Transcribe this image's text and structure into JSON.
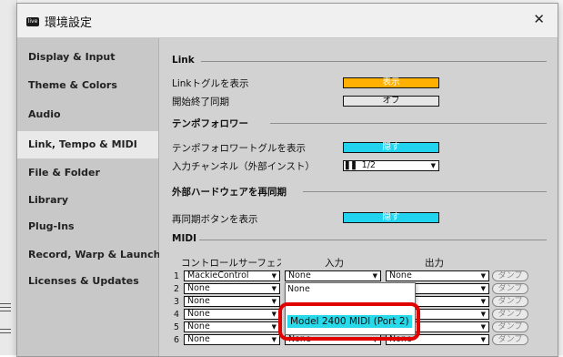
{
  "window": {
    "app_icon_text": "live",
    "title": "環境設定",
    "close_glyph": "✕"
  },
  "sidebar": {
    "items": [
      {
        "label": "Display & Input"
      },
      {
        "label": "Theme & Colors"
      },
      {
        "label": "Audio"
      },
      {
        "label": "Link, Tempo & MIDI",
        "selected": true
      },
      {
        "label": "File & Folder"
      },
      {
        "label": "Library"
      },
      {
        "label": "Plug-Ins"
      },
      {
        "label": "Record, Warp & Launch"
      },
      {
        "label": "Licenses & Updates"
      }
    ]
  },
  "link": {
    "header": "Link",
    "toggle_label": "Linkトグルを表示",
    "toggle_value": "表示",
    "sync_label": "開始終了同期",
    "sync_value": "オフ"
  },
  "tempo": {
    "header": "テンポフォロワー",
    "toggle_label": "テンポフォロワートグルを表示",
    "toggle_value": "隠す",
    "channel_label": "入力チャンネル（外部インスト）",
    "channel_value": "1/2"
  },
  "resync": {
    "header": "外部ハードウェアを再同期",
    "button_label": "再同期ボタンを表示",
    "button_value": "隠す"
  },
  "midi": {
    "header": "MIDI",
    "col_surface": "コントロールサーフェス",
    "col_input": "入力",
    "col_output": "出力",
    "dump_label": "ダンプ",
    "rows": [
      {
        "num": "1",
        "surface": "MackieControl",
        "input": "None",
        "output": "None"
      },
      {
        "num": "2",
        "surface": "None",
        "input": "None",
        "output": ""
      },
      {
        "num": "3",
        "surface": "None",
        "input": "",
        "output": ""
      },
      {
        "num": "4",
        "surface": "None",
        "input": "",
        "output": ""
      },
      {
        "num": "5",
        "surface": "None",
        "input": "",
        "output": ""
      },
      {
        "num": "6",
        "surface": "None",
        "input": "None",
        "output": "None"
      }
    ],
    "popup": {
      "items": [
        {
          "label": "None"
        },
        {
          "label": "Model 2400 MIDI (Port 2)",
          "highlighted": true
        }
      ]
    }
  },
  "colors": {
    "accent_orange": "#ffb000",
    "accent_cyan": "#22d3f0",
    "highlight_red": "#e00000",
    "popup_highlight": "#27d9e9"
  }
}
